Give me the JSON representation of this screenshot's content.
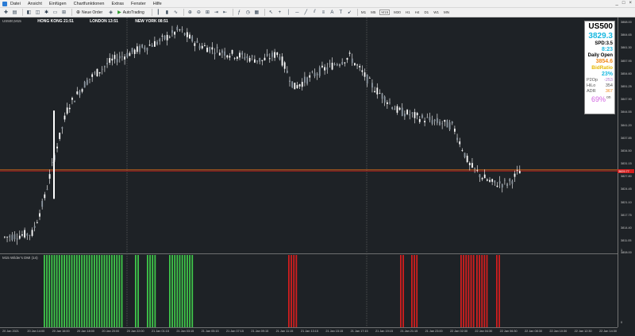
{
  "menu": {
    "items": [
      "Datei",
      "Ansicht",
      "Einfügen",
      "Chartfunktionen",
      "Extras",
      "Fenster",
      "Hilfe"
    ],
    "window_controls": [
      "_",
      "□",
      "×"
    ]
  },
  "toolbar": {
    "new_order_label": "Neue Order",
    "autotrading_label": "AutoTrading",
    "timeframes": [
      "M1",
      "M5",
      "M15",
      "M30",
      "H1",
      "H4",
      "D1",
      "W1",
      "MN"
    ],
    "active_timeframe": "M15",
    "icons": [
      "new-chart-icon",
      "profiles-icon",
      "market-watch-icon",
      "data-window-icon",
      "navigator-icon",
      "terminal-icon",
      "tester-icon",
      "zoom-in-icon",
      "zoom-out-icon",
      "tile-icon",
      "autoscroll-icon",
      "chart-shift-icon",
      "indicators-icon",
      "periods-icon",
      "templates-icon",
      "cursor-icon",
      "crosshair-icon",
      "vertical-line-icon",
      "horizontal-line-icon",
      "trendline-icon",
      "channel-icon",
      "fibonacci-icon",
      "text-icon",
      "label-icon",
      "arrows-icon"
    ]
  },
  "chart": {
    "symbol_label": "US500,M15",
    "sessions": [
      {
        "label": "HONG KONG 21:51",
        "color": "#c8102e"
      },
      {
        "label": "LONDON 13:51",
        "color": "#1e5aa8"
      },
      {
        "label": "NEW YORK 08:51",
        "color": "#1e5aa8"
      }
    ],
    "price_axis": [
      "3868.00",
      "3864.65",
      "3861.30",
      "3857.95",
      "3854.60",
      "3851.25",
      "3847.90",
      "3844.55",
      "3841.20",
      "3837.85",
      "3834.50",
      "3831.15",
      "3827.80",
      "3824.45",
      "3821.10",
      "3817.75",
      "3814.40",
      "3811.05",
      "3808.00"
    ],
    "price_range": [
      3808.0,
      3868.0
    ],
    "current_price_marker": "3829.77",
    "horizontal_line_price": 3829.3,
    "time_axis": [
      "20 Jan 2021",
      "20 Jan 14:00",
      "20 Jan 16:00",
      "20 Jan 18:00",
      "20 Jan 20:00",
      "20 Jan 22:00",
      "21 Jan 01:15",
      "21 Jan 03:15",
      "21 Jan 05:15",
      "21 Jan 07:15",
      "21 Jan 09:15",
      "21 Jan 11:15",
      "21 Jan 13:15",
      "21 Jan 15:15",
      "21 Jan 17:15",
      "21 Jan 19:15",
      "21 Jan 21:15",
      "21 Jan 23:00",
      "22 Jan 02:30",
      "22 Jan 04:30",
      "22 Jan 06:30",
      "22 Jan 08:30",
      "22 Jan 10:30",
      "22 Jan 12:30",
      "22 Jan 14:30"
    ],
    "colors": {
      "background": "#1e2226",
      "candle": "#ffffff",
      "line_orange": "#ff7a1a",
      "line_red": "#d21e1e",
      "bar_green": "#3fc74a",
      "bar_red": "#d21e1e",
      "grid": "#6a6a6a"
    },
    "indicator_label": "M15 Wilder's DMI (14)",
    "indicator_scale": [
      "1",
      "0"
    ]
  },
  "info_panel": {
    "symbol": "US500",
    "price": "3829.3",
    "spread": "SPD:3.5",
    "time": "8:23",
    "daily_open_label": "Daily Open",
    "daily_open_value": "3854.6",
    "bid_ratio_label": "BidRatio",
    "bid_ratio_value": "23%",
    "p2op_label": "P2Op",
    "p2op_value": "-253",
    "hilo_label": "HiLo",
    "hilo_value": "354",
    "adr_label": "ADR",
    "adr_value": "367",
    "percent_value": "69%",
    "percent_suffix": "on"
  }
}
